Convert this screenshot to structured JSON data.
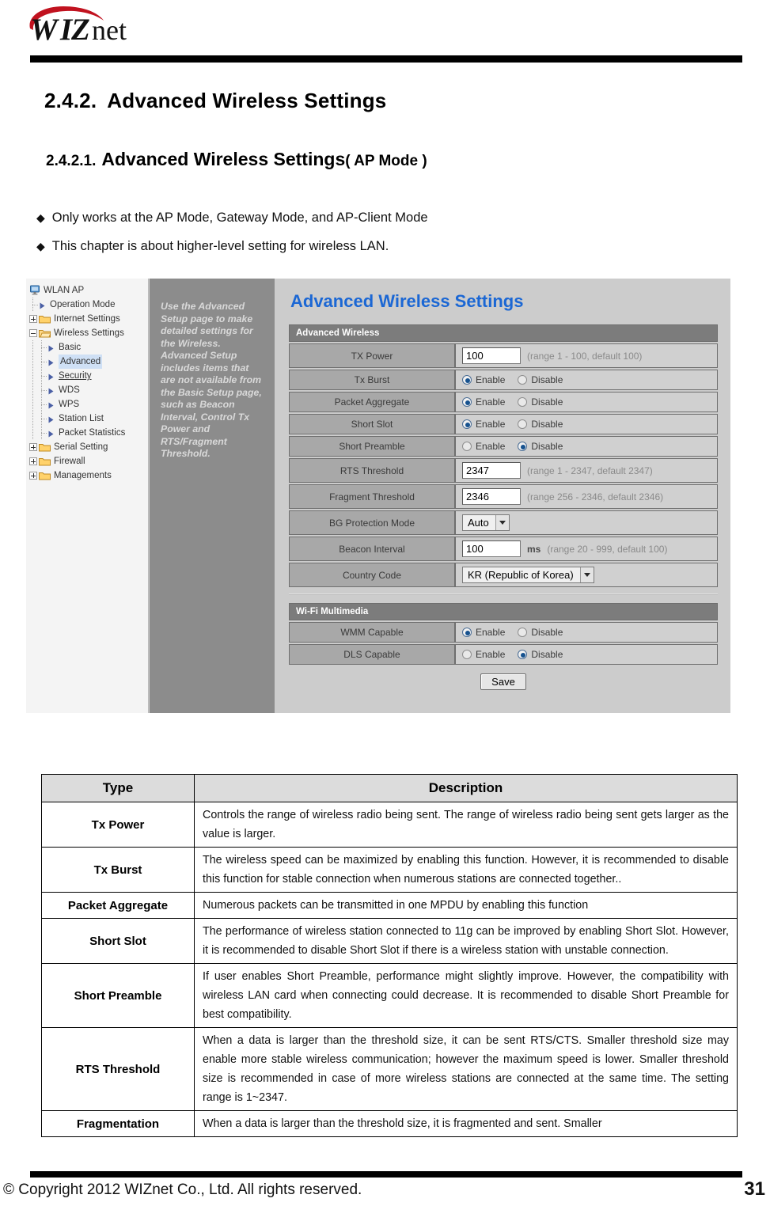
{
  "brand": {
    "logo_text": "WIZnet"
  },
  "headings": {
    "section_number": "2.4.2.",
    "section_title": "Advanced  Wireless  Settings",
    "sub_number": "2.4.2.1.",
    "sub_title": "Advanced  Wireless  Settings",
    "sub_suffix": "( AP Mode )"
  },
  "bullets": [
    {
      "marker": "◆",
      "text": "Only works at the AP Mode, Gateway Mode, and AP-Client Mode"
    },
    {
      "marker": "◆",
      "text": "This chapter is about higher-level setting for wireless LAN."
    }
  ],
  "screenshot": {
    "tree": {
      "root": "WLAN AP",
      "items": [
        {
          "label": "Operation Mode",
          "icon": "arrow-icon",
          "depth": 1,
          "expander": "none",
          "state": "normal"
        },
        {
          "label": "Internet Settings",
          "icon": "folder-closed-icon",
          "depth": 1,
          "expander": "plus",
          "state": "normal"
        },
        {
          "label": "Wireless Settings",
          "icon": "folder-open-icon",
          "depth": 1,
          "expander": "minus",
          "state": "normal"
        },
        {
          "label": "Basic",
          "icon": "arrow-icon",
          "depth": 2,
          "expander": "none",
          "state": "normal"
        },
        {
          "label": "Advanced",
          "icon": "arrow-icon",
          "depth": 2,
          "expander": "none",
          "state": "selected"
        },
        {
          "label": "Security",
          "icon": "arrow-icon",
          "depth": 2,
          "expander": "none",
          "state": "underlined"
        },
        {
          "label": "WDS",
          "icon": "arrow-icon",
          "depth": 2,
          "expander": "none",
          "state": "normal"
        },
        {
          "label": "WPS",
          "icon": "arrow-icon",
          "depth": 2,
          "expander": "none",
          "state": "normal"
        },
        {
          "label": "Station List",
          "icon": "arrow-icon",
          "depth": 2,
          "expander": "none",
          "state": "normal"
        },
        {
          "label": "Packet Statistics",
          "icon": "arrow-icon",
          "depth": 2,
          "expander": "none",
          "state": "normal"
        },
        {
          "label": "Serial Setting",
          "icon": "folder-closed-icon",
          "depth": 1,
          "expander": "plus",
          "state": "normal"
        },
        {
          "label": "Firewall",
          "icon": "folder-closed-icon",
          "depth": 1,
          "expander": "plus",
          "state": "normal"
        },
        {
          "label": "Managements",
          "icon": "folder-closed-icon",
          "depth": 1,
          "expander": "plus",
          "state": "normal"
        }
      ]
    },
    "help_text": "Use the Advanced Setup page to make detailed settings for the Wireless. Advanced Setup includes items that are not available from the Basic Setup page, such as Beacon Interval, Control Tx Power and RTS/Fragment Threshold.",
    "panel_title": "Advanced Wireless Settings",
    "section1_header": "Advanced Wireless",
    "section1_rows": [
      {
        "key": "TX Power",
        "kind": "text",
        "value": "100",
        "hint": "(range 1 - 100, default 100)",
        "unit": ""
      },
      {
        "key": "Tx Burst",
        "kind": "radio",
        "options": [
          "Enable",
          "Disable"
        ],
        "selected": "Enable"
      },
      {
        "key": "Packet Aggregate",
        "kind": "radio",
        "options": [
          "Enable",
          "Disable"
        ],
        "selected": "Enable"
      },
      {
        "key": "Short Slot",
        "kind": "radio",
        "options": [
          "Enable",
          "Disable"
        ],
        "selected": "Enable"
      },
      {
        "key": "Short Preamble",
        "kind": "radio",
        "options": [
          "Enable",
          "Disable"
        ],
        "selected": "Disable"
      },
      {
        "key": "RTS Threshold",
        "kind": "text",
        "value": "2347",
        "hint": "(range 1 - 2347, default 2347)",
        "unit": ""
      },
      {
        "key": "Fragment Threshold",
        "kind": "text",
        "value": "2346",
        "hint": "(range 256 - 2346, default 2346)",
        "unit": ""
      },
      {
        "key": "BG Protection Mode",
        "kind": "select",
        "value": "Auto"
      },
      {
        "key": "Beacon Interval",
        "kind": "text",
        "value": "100",
        "hint": "(range 20 - 999, default 100)",
        "unit": "ms"
      },
      {
        "key": "Country Code",
        "kind": "select",
        "value": "KR (Republic of Korea)"
      }
    ],
    "section2_header": "Wi-Fi Multimedia",
    "section2_rows": [
      {
        "key": "WMM Capable",
        "kind": "radio",
        "options": [
          "Enable",
          "Disable"
        ],
        "selected": "Enable"
      },
      {
        "key": "DLS Capable",
        "kind": "radio",
        "options": [
          "Enable",
          "Disable"
        ],
        "selected": "Disable"
      }
    ],
    "save_label": "Save",
    "accent_color": "#1b67d4"
  },
  "desc_table": {
    "headers": [
      "Type",
      "Description"
    ],
    "rows": [
      {
        "type": "Tx Power",
        "description": "Controls the range of wireless radio being sent. The range of wireless radio being sent gets larger as the value is larger."
      },
      {
        "type": "Tx Burst",
        "description": "The wireless speed can be maximized by enabling this function. However, it is recommended to disable this function for stable connection when numerous stations are connected together.."
      },
      {
        "type": "Packet Aggregate",
        "description": "Numerous packets can be transmitted in one MPDU by enabling this function"
      },
      {
        "type": "Short Slot",
        "description": "The performance of wireless station connected to 11g can be improved by enabling Short Slot. However, it is recommended to disable Short Slot if there is a wireless station with unstable connection."
      },
      {
        "type": "Short Preamble",
        "description": "If user enables Short Preamble, performance might slightly improve. However, the compatibility with wireless LAN card when connecting could decrease. It is recommended to disable Short Preamble for best compatibility."
      },
      {
        "type": "RTS Threshold",
        "description": "When a data is larger than the threshold size, it can be sent RTS/CTS. Smaller threshold size may enable more stable wireless communication; however the maximum speed is lower. Smaller threshold size is recommended in case of more wireless stations are connected at the same time. The setting range is 1~2347."
      },
      {
        "type": "Fragmentation",
        "description": "When a data is larger than the threshold size, it is fragmented and sent. Smaller"
      }
    ]
  },
  "footer": {
    "copyright": "© Copyright 2012 WIZnet Co., Ltd. All rights reserved.",
    "page_number": "31"
  }
}
